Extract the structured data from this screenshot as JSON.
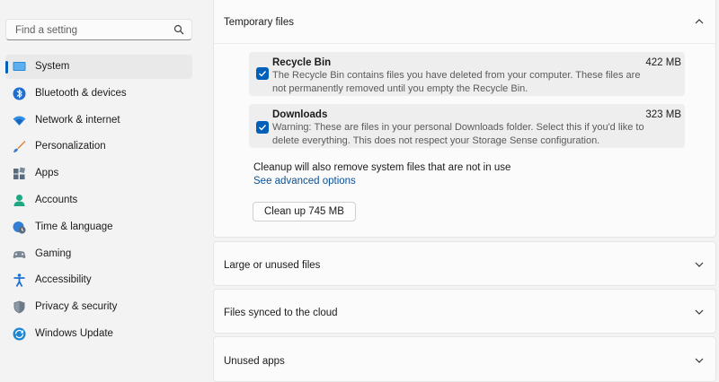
{
  "search": {
    "placeholder": "Find a setting"
  },
  "sidebar": {
    "items": [
      {
        "label": "System",
        "icon": "system-icon"
      },
      {
        "label": "Bluetooth & devices",
        "icon": "bluetooth-icon"
      },
      {
        "label": "Network & internet",
        "icon": "wifi-icon"
      },
      {
        "label": "Personalization",
        "icon": "brush-icon"
      },
      {
        "label": "Apps",
        "icon": "apps-icon"
      },
      {
        "label": "Accounts",
        "icon": "account-icon"
      },
      {
        "label": "Time & language",
        "icon": "globe-clock-icon"
      },
      {
        "label": "Gaming",
        "icon": "gamepad-icon"
      },
      {
        "label": "Accessibility",
        "icon": "accessibility-icon"
      },
      {
        "label": "Privacy & security",
        "icon": "shield-icon"
      },
      {
        "label": "Windows Update",
        "icon": "update-icon"
      }
    ]
  },
  "temporary_files": {
    "title": "Temporary files",
    "items": [
      {
        "name": "Recycle Bin",
        "size": "422 MB",
        "checked": true,
        "description": "The Recycle Bin contains files you have deleted from your computer. These files are not permanently removed until you empty the Recycle Bin."
      },
      {
        "name": "Downloads",
        "size": "323 MB",
        "checked": true,
        "description": "Warning: These are files in your personal Downloads folder. Select this if you'd like to delete everything. This does not respect your Storage Sense configuration."
      }
    ],
    "note": "Cleanup will also remove system files that are not in use",
    "advanced_link": "See advanced options",
    "cleanup_button": "Clean up 745 MB"
  },
  "sections": [
    {
      "title": "Large or unused files"
    },
    {
      "title": "Files synced to the cloud"
    },
    {
      "title": "Unused apps"
    }
  ],
  "colors": {
    "accent": "#005fb8",
    "link": "#0a4f96"
  }
}
